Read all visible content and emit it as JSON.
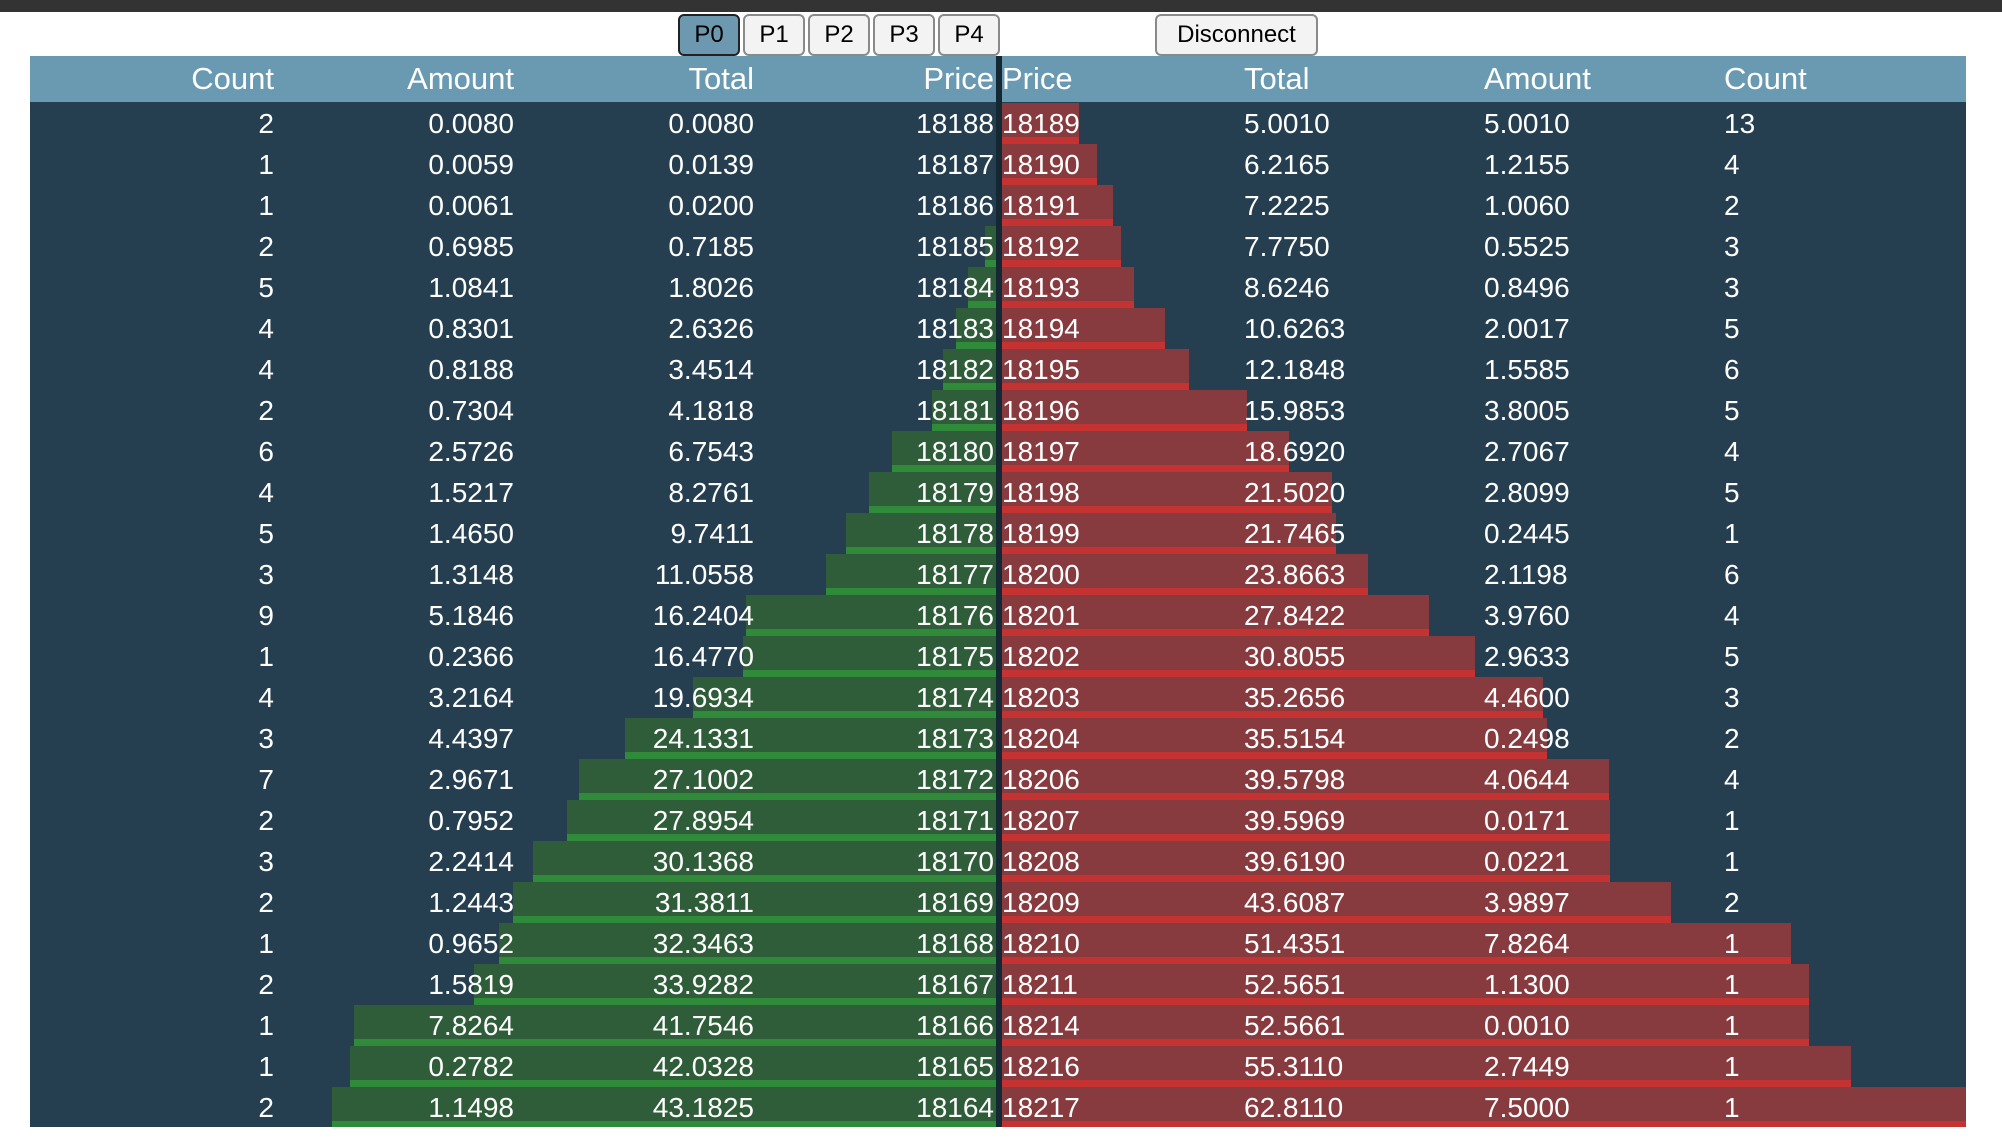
{
  "toolbar": {
    "precision_buttons": [
      "P0",
      "P1",
      "P2",
      "P3",
      "P4"
    ],
    "active_precision": "P0",
    "disconnect_label": "Disconnect"
  },
  "colors": {
    "header_bg": "#6a9ab2",
    "table_bg": "#253f50",
    "bid_bar": "#2f5d39",
    "bid_bar_edge": "#2f8a3a",
    "ask_bar": "#873b3f",
    "ask_bar_edge": "#c53232"
  },
  "bids": {
    "headers": [
      "Count",
      "Amount",
      "Total",
      "Price"
    ],
    "rows": [
      {
        "count": "2",
        "amount": "0.0080",
        "total": "0.0080",
        "price": "18188"
      },
      {
        "count": "1",
        "amount": "0.0059",
        "total": "0.0139",
        "price": "18187"
      },
      {
        "count": "1",
        "amount": "0.0061",
        "total": "0.0200",
        "price": "18186"
      },
      {
        "count": "2",
        "amount": "0.6985",
        "total": "0.7185",
        "price": "18185"
      },
      {
        "count": "5",
        "amount": "1.0841",
        "total": "1.8026",
        "price": "18184"
      },
      {
        "count": "4",
        "amount": "0.8301",
        "total": "2.6326",
        "price": "18183"
      },
      {
        "count": "4",
        "amount": "0.8188",
        "total": "3.4514",
        "price": "18182"
      },
      {
        "count": "2",
        "amount": "0.7304",
        "total": "4.1818",
        "price": "18181"
      },
      {
        "count": "6",
        "amount": "2.5726",
        "total": "6.7543",
        "price": "18180"
      },
      {
        "count": "4",
        "amount": "1.5217",
        "total": "8.2761",
        "price": "18179"
      },
      {
        "count": "5",
        "amount": "1.4650",
        "total": "9.7411",
        "price": "18178"
      },
      {
        "count": "3",
        "amount": "1.3148",
        "total": "11.0558",
        "price": "18177"
      },
      {
        "count": "9",
        "amount": "5.1846",
        "total": "16.2404",
        "price": "18176"
      },
      {
        "count": "1",
        "amount": "0.2366",
        "total": "16.4770",
        "price": "18175"
      },
      {
        "count": "4",
        "amount": "3.2164",
        "total": "19.6934",
        "price": "18174"
      },
      {
        "count": "3",
        "amount": "4.4397",
        "total": "24.1331",
        "price": "18173"
      },
      {
        "count": "7",
        "amount": "2.9671",
        "total": "27.1002",
        "price": "18172"
      },
      {
        "count": "2",
        "amount": "0.7952",
        "total": "27.8954",
        "price": "18171"
      },
      {
        "count": "3",
        "amount": "2.2414",
        "total": "30.1368",
        "price": "18170"
      },
      {
        "count": "2",
        "amount": "1.2443",
        "total": "31.3811",
        "price": "18169"
      },
      {
        "count": "1",
        "amount": "0.9652",
        "total": "32.3463",
        "price": "18168"
      },
      {
        "count": "2",
        "amount": "1.5819",
        "total": "33.9282",
        "price": "18167"
      },
      {
        "count": "1",
        "amount": "7.8264",
        "total": "41.7546",
        "price": "18166"
      },
      {
        "count": "1",
        "amount": "0.2782",
        "total": "42.0328",
        "price": "18165"
      },
      {
        "count": "2",
        "amount": "1.1498",
        "total": "43.1825",
        "price": "18164"
      }
    ]
  },
  "asks": {
    "headers": [
      "Price",
      "Total",
      "Amount",
      "Count"
    ],
    "rows": [
      {
        "price": "18189",
        "total": "5.0010",
        "amount": "5.0010",
        "count": "13"
      },
      {
        "price": "18190",
        "total": "6.2165",
        "amount": "1.2155",
        "count": "4"
      },
      {
        "price": "18191",
        "total": "7.2225",
        "amount": "1.0060",
        "count": "2"
      },
      {
        "price": "18192",
        "total": "7.7750",
        "amount": "0.5525",
        "count": "3"
      },
      {
        "price": "18193",
        "total": "8.6246",
        "amount": "0.8496",
        "count": "3"
      },
      {
        "price": "18194",
        "total": "10.6263",
        "amount": "2.0017",
        "count": "5"
      },
      {
        "price": "18195",
        "total": "12.1848",
        "amount": "1.5585",
        "count": "6"
      },
      {
        "price": "18196",
        "total": "15.9853",
        "amount": "3.8005",
        "count": "5"
      },
      {
        "price": "18197",
        "total": "18.6920",
        "amount": "2.7067",
        "count": "4"
      },
      {
        "price": "18198",
        "total": "21.5020",
        "amount": "2.8099",
        "count": "5"
      },
      {
        "price": "18199",
        "total": "21.7465",
        "amount": "0.2445",
        "count": "1"
      },
      {
        "price": "18200",
        "total": "23.8663",
        "amount": "2.1198",
        "count": "6"
      },
      {
        "price": "18201",
        "total": "27.8422",
        "amount": "3.9760",
        "count": "4"
      },
      {
        "price": "18202",
        "total": "30.8055",
        "amount": "2.9633",
        "count": "5"
      },
      {
        "price": "18203",
        "total": "35.2656",
        "amount": "4.4600",
        "count": "3"
      },
      {
        "price": "18204",
        "total": "35.5154",
        "amount": "0.2498",
        "count": "2"
      },
      {
        "price": "18206",
        "total": "39.5798",
        "amount": "4.0644",
        "count": "4"
      },
      {
        "price": "18207",
        "total": "39.5969",
        "amount": "0.0171",
        "count": "1"
      },
      {
        "price": "18208",
        "total": "39.6190",
        "amount": "0.0221",
        "count": "1"
      },
      {
        "price": "18209",
        "total": "43.6087",
        "amount": "3.9897",
        "count": "2"
      },
      {
        "price": "18210",
        "total": "51.4351",
        "amount": "7.8264",
        "count": "1"
      },
      {
        "price": "18211",
        "total": "52.5651",
        "amount": "1.1300",
        "count": "1"
      },
      {
        "price": "18214",
        "total": "52.5661",
        "amount": "0.0010",
        "count": "1"
      },
      {
        "price": "18216",
        "total": "55.3110",
        "amount": "2.7449",
        "count": "1"
      },
      {
        "price": "18217",
        "total": "62.8110",
        "amount": "7.5000",
        "count": "1"
      }
    ]
  }
}
